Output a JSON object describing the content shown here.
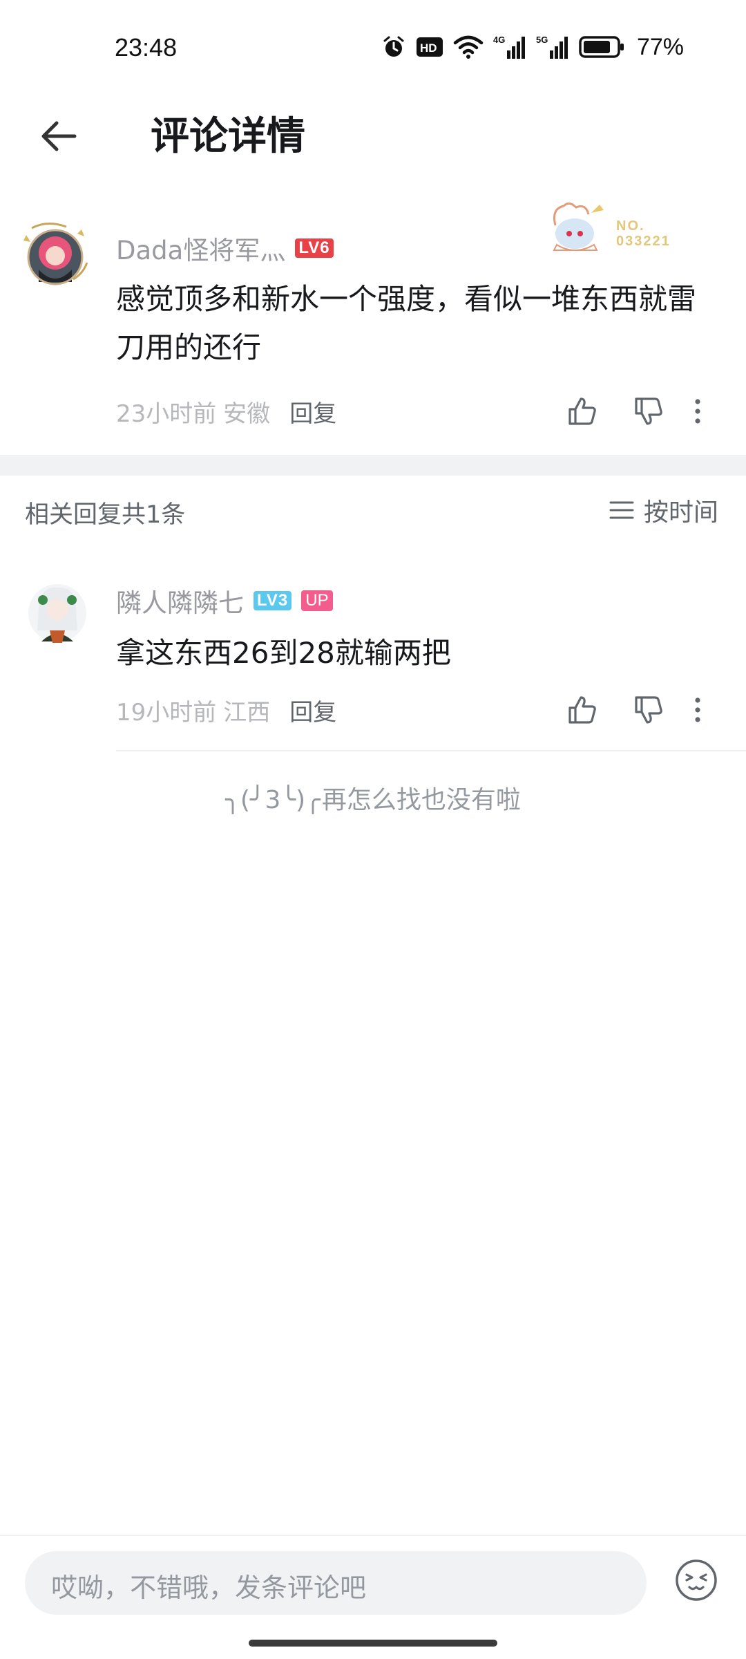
{
  "status_bar": {
    "time": "23:48",
    "battery": "77%",
    "icons": [
      "alarm-icon",
      "hd-icon",
      "wifi-icon",
      "signal-4g-icon",
      "signal-5g-icon",
      "battery-icon"
    ]
  },
  "header": {
    "title": "评论详情",
    "back_icon": "arrow-left-icon"
  },
  "main_comment": {
    "username": "Dada怪将军灬",
    "level": "LV6",
    "fan_badge_no": "NO.\n033221",
    "text": "感觉顶多和新水一个强度，看似一堆东西就雷刀用的还行",
    "time": "23小时前",
    "location": "安徽",
    "reply_label": "回复"
  },
  "replies_header": {
    "count_text": "相关回复共1条",
    "sort_label": "按时间"
  },
  "reply": {
    "username": "隣人隣隣七",
    "level": "LV3",
    "up_badge": "UP",
    "text": "拿这东西26到28就输两把",
    "time": "19小时前",
    "location": "江西",
    "reply_label": "回复"
  },
  "end_message": {
    "face": "╮(╯3╰)╭",
    "text": "再怎么找也没有啦"
  },
  "input": {
    "placeholder": "哎呦，不错哦，发条评论吧"
  },
  "colors": {
    "level6": "#e84147",
    "level3": "#5bc8ee",
    "up": "#f25d8e",
    "muted": "#9499a0"
  }
}
